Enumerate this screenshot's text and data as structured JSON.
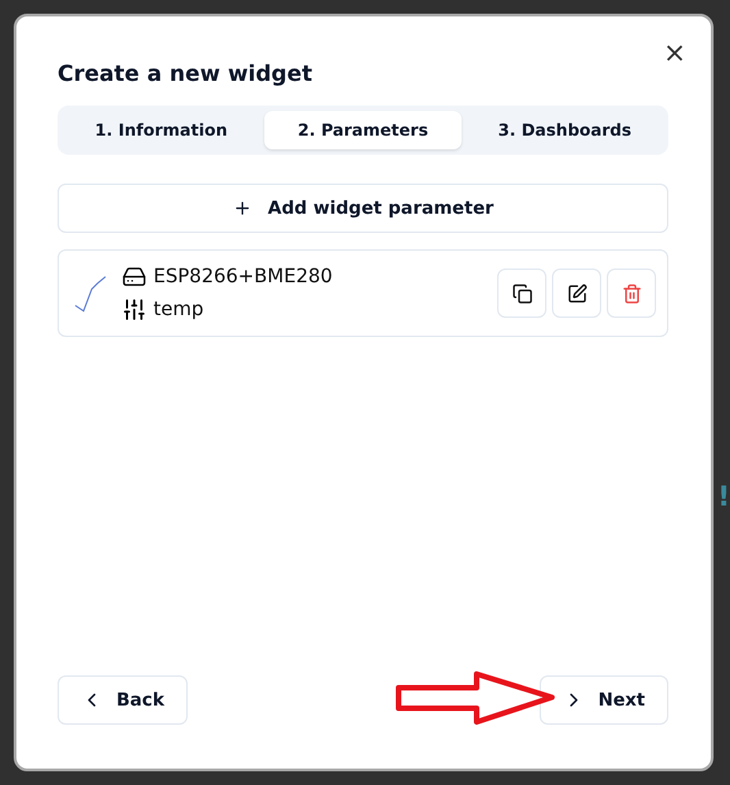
{
  "dialog": {
    "title": "Create a new widget",
    "close_label": "×"
  },
  "tabs": [
    {
      "label": "1. Information",
      "selected": false
    },
    {
      "label": "2. Parameters",
      "selected": true
    },
    {
      "label": "3. Dashboards",
      "selected": false
    }
  ],
  "add_button": {
    "label": "Add widget parameter"
  },
  "parameters": [
    {
      "device": "ESP8266+BME280",
      "name": "temp"
    }
  ],
  "footer": {
    "back": "Back",
    "next": "Next"
  },
  "backdrop_mark": "!"
}
